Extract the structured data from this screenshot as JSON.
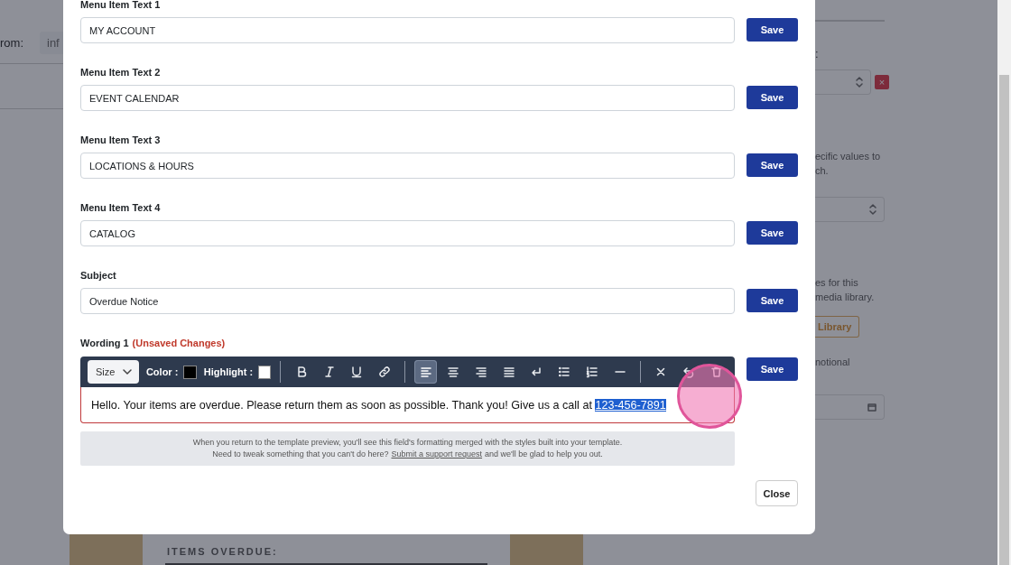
{
  "background": {
    "from_label": "rom:",
    "from_value": "inf",
    "right_colon": ":",
    "remove_button": "×",
    "right_texts": [
      "ecific values to",
      "ch.",
      "es for this",
      "media library."
    ],
    "library_button": "Library",
    "promo_text": "notional",
    "section_heading": "ITEMS OVERDUE:"
  },
  "fields": [
    {
      "label": "Menu Item Text 1",
      "value": "MY ACCOUNT",
      "button": "Save"
    },
    {
      "label": "Menu Item Text 2",
      "value": "EVENT CALENDAR",
      "button": "Save"
    },
    {
      "label": "Menu Item Text 3",
      "value": "LOCATIONS & HOURS",
      "button": "Save"
    },
    {
      "label": "Menu Item Text 4",
      "value": "CATALOG",
      "button": "Save"
    },
    {
      "label": "Subject",
      "value": "Overdue Notice",
      "button": "Save"
    }
  ],
  "wording": {
    "label": "Wording 1",
    "status": "(Unsaved Changes)",
    "button": "Save",
    "toolbar": {
      "size": "Size",
      "color_label": "Color :",
      "highlight_label": "Highlight :",
      "tools": [
        {
          "kind": "bold",
          "selected": false
        },
        {
          "kind": "italic",
          "selected": false
        },
        {
          "kind": "underline",
          "selected": false
        },
        {
          "kind": "link",
          "selected": false
        },
        {
          "kind": "separator"
        },
        {
          "kind": "align-left",
          "selected": true
        },
        {
          "kind": "align-center",
          "selected": false
        },
        {
          "kind": "align-right",
          "selected": false
        },
        {
          "kind": "justify",
          "selected": false
        },
        {
          "kind": "line-break",
          "selected": false
        },
        {
          "kind": "bullets",
          "selected": false
        },
        {
          "kind": "numbers",
          "selected": false
        },
        {
          "kind": "rule",
          "selected": false
        },
        {
          "kind": "separator"
        },
        {
          "kind": "clear",
          "selected": false
        },
        {
          "kind": "undo",
          "selected": false
        },
        {
          "kind": "delete",
          "selected": false
        }
      ]
    },
    "text": "Hello. Your items are overdue. Please return them as soon as possible. Thank you! Give us a call at ",
    "selected_text": "123-456-7891"
  },
  "note": {
    "line1": "When you return to the template preview, you'll see this field's formatting merged with the styles built into your template.",
    "line2_before": "Need to tweak something that you can't do here?",
    "link": "Submit a support request",
    "line2_after": "and we'll be glad to help you out."
  },
  "close_button": "Close"
}
